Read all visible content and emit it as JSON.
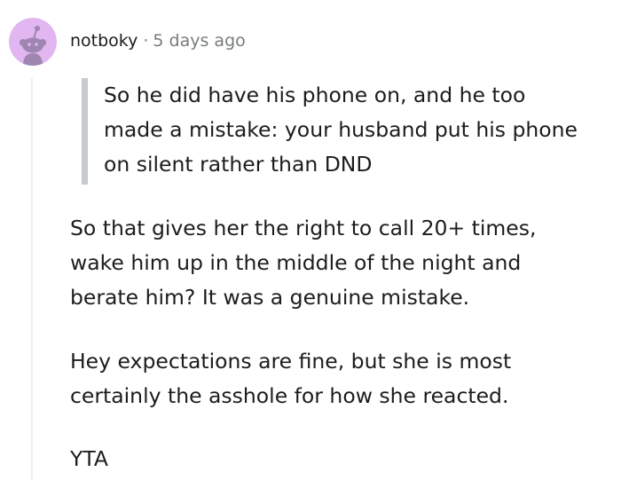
{
  "comment": {
    "author": "notboky",
    "separator": "·",
    "timestamp": "5 days ago",
    "quote_lines": [
      "So he did have his phone on, and he too",
      "made a mistake: your husband put his phone",
      "on silent rather than DND"
    ],
    "paragraph1_lines": [
      "So that gives her the right to call 20+ times,",
      "wake him up in the middle of the night and",
      "berate him? It was a genuine mistake."
    ],
    "paragraph2_lines": [
      "Hey expectations are fine, but she is most",
      "certainly the asshole for how she reacted."
    ],
    "paragraph3": "YTA"
  },
  "avatar": {
    "icon": "snoo-avatar-icon",
    "background_color": "#e2b6f0",
    "figure_color": "#9f86b0"
  },
  "colors": {
    "text": "#1c1c1c",
    "meta": "#787c7e",
    "quote_bar": "#c8cbcd",
    "thread_line": "#edeff1"
  }
}
